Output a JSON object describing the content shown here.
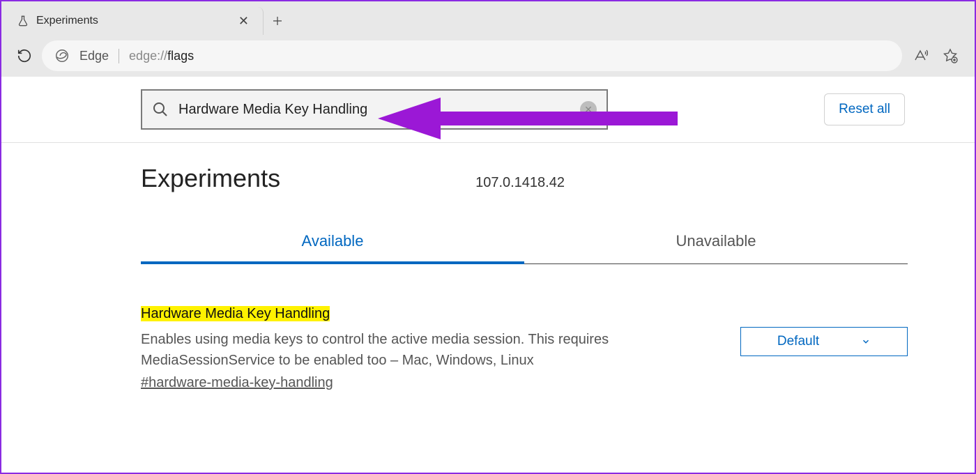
{
  "browser": {
    "tab_title": "Experiments",
    "omnibox_label": "Edge",
    "url_prefix": "edge://",
    "url_suffix": "flags"
  },
  "searchbar": {
    "value": "Hardware Media Key Handling",
    "reset_label": "Reset all"
  },
  "header": {
    "title": "Experiments",
    "version": "107.0.1418.42"
  },
  "tabs": {
    "available": "Available",
    "unavailable": "Unavailable"
  },
  "flag": {
    "title": "Hardware Media Key Handling",
    "description": "Enables using media keys to control the active media session. This requires MediaSessionService to be enabled too – Mac, Windows, Linux",
    "anchor": "#hardware-media-key-handling",
    "select_value": "Default"
  }
}
